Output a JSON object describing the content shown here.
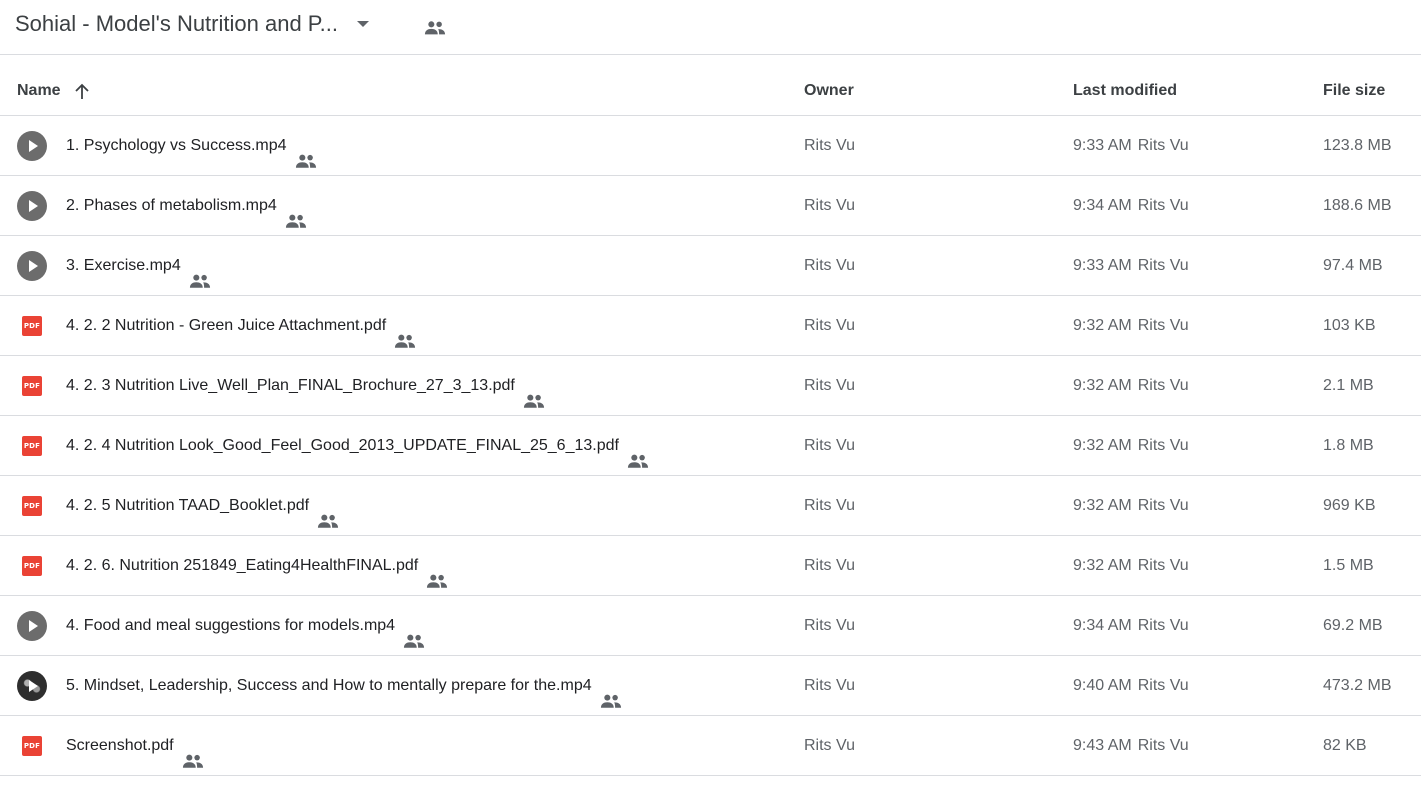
{
  "topbar": {
    "folder_title": "Sohial - Model's Nutrition and P...",
    "title_dropdown_icon": "caret-down-icon",
    "shared_icon": "people-icon"
  },
  "columns": {
    "name": "Name",
    "owner": "Owner",
    "last_modified": "Last modified",
    "file_size": "File size",
    "sort_icon": "arrow-up-icon"
  },
  "files": [
    {
      "name": "1. Psychology vs Success.mp4",
      "type": "video",
      "owner": "Rits Vu",
      "time": "9:33 AM",
      "modified_by": "Rits Vu",
      "size": "123.8 MB"
    },
    {
      "name": "2. Phases of metabolism.mp4",
      "type": "video",
      "owner": "Rits Vu",
      "time": "9:34 AM",
      "modified_by": "Rits Vu",
      "size": "188.6 MB"
    },
    {
      "name": "3. Exercise.mp4",
      "type": "video",
      "owner": "Rits Vu",
      "time": "9:33 AM",
      "modified_by": "Rits Vu",
      "size": "97.4 MB"
    },
    {
      "name": "4.  2. 2 Nutrition - Green Juice Attachment.pdf",
      "type": "pdf",
      "owner": "Rits Vu",
      "time": "9:32 AM",
      "modified_by": "Rits Vu",
      "size": "103 KB"
    },
    {
      "name": "4. 2. 3 Nutrition Live_Well_Plan_FINAL_Brochure_27_3_13.pdf",
      "type": "pdf",
      "owner": "Rits Vu",
      "time": "9:32 AM",
      "modified_by": "Rits Vu",
      "size": "2.1 MB"
    },
    {
      "name": "4. 2. 4 Nutrition Look_Good_Feel_Good_2013_UPDATE_FINAL_25_6_13.pdf",
      "type": "pdf",
      "owner": "Rits Vu",
      "time": "9:32 AM",
      "modified_by": "Rits Vu",
      "size": "1.8 MB"
    },
    {
      "name": "4. 2. 5 Nutrition TAAD_Booklet.pdf",
      "type": "pdf",
      "owner": "Rits Vu",
      "time": "9:32 AM",
      "modified_by": "Rits Vu",
      "size": "969 KB"
    },
    {
      "name": "4. 2. 6. Nutrition 251849_Eating4HealthFINAL.pdf",
      "type": "pdf",
      "owner": "Rits Vu",
      "time": "9:32 AM",
      "modified_by": "Rits Vu",
      "size": "1.5 MB"
    },
    {
      "name": "4. Food and meal suggestions for models.mp4",
      "type": "video",
      "owner": "Rits Vu",
      "time": "9:34 AM",
      "modified_by": "Rits Vu",
      "size": "69.2 MB"
    },
    {
      "name": "5. Mindset, Leadership, Success and How to mentally prepare for the.mp4",
      "type": "video-thumb",
      "owner": "Rits Vu",
      "time": "9:40 AM",
      "modified_by": "Rits Vu",
      "size": "473.2 MB"
    },
    {
      "name": "Screenshot.pdf",
      "type": "pdf",
      "owner": "Rits Vu",
      "time": "9:43 AM",
      "modified_by": "Rits Vu",
      "size": "82 KB"
    }
  ],
  "icons": {
    "pdf_label": "PDF"
  },
  "colors": {
    "pdf_red": "#ea4335",
    "video_gray": "#6c6c6c",
    "divider": "#dadce0",
    "muted_text": "#5f6368"
  }
}
